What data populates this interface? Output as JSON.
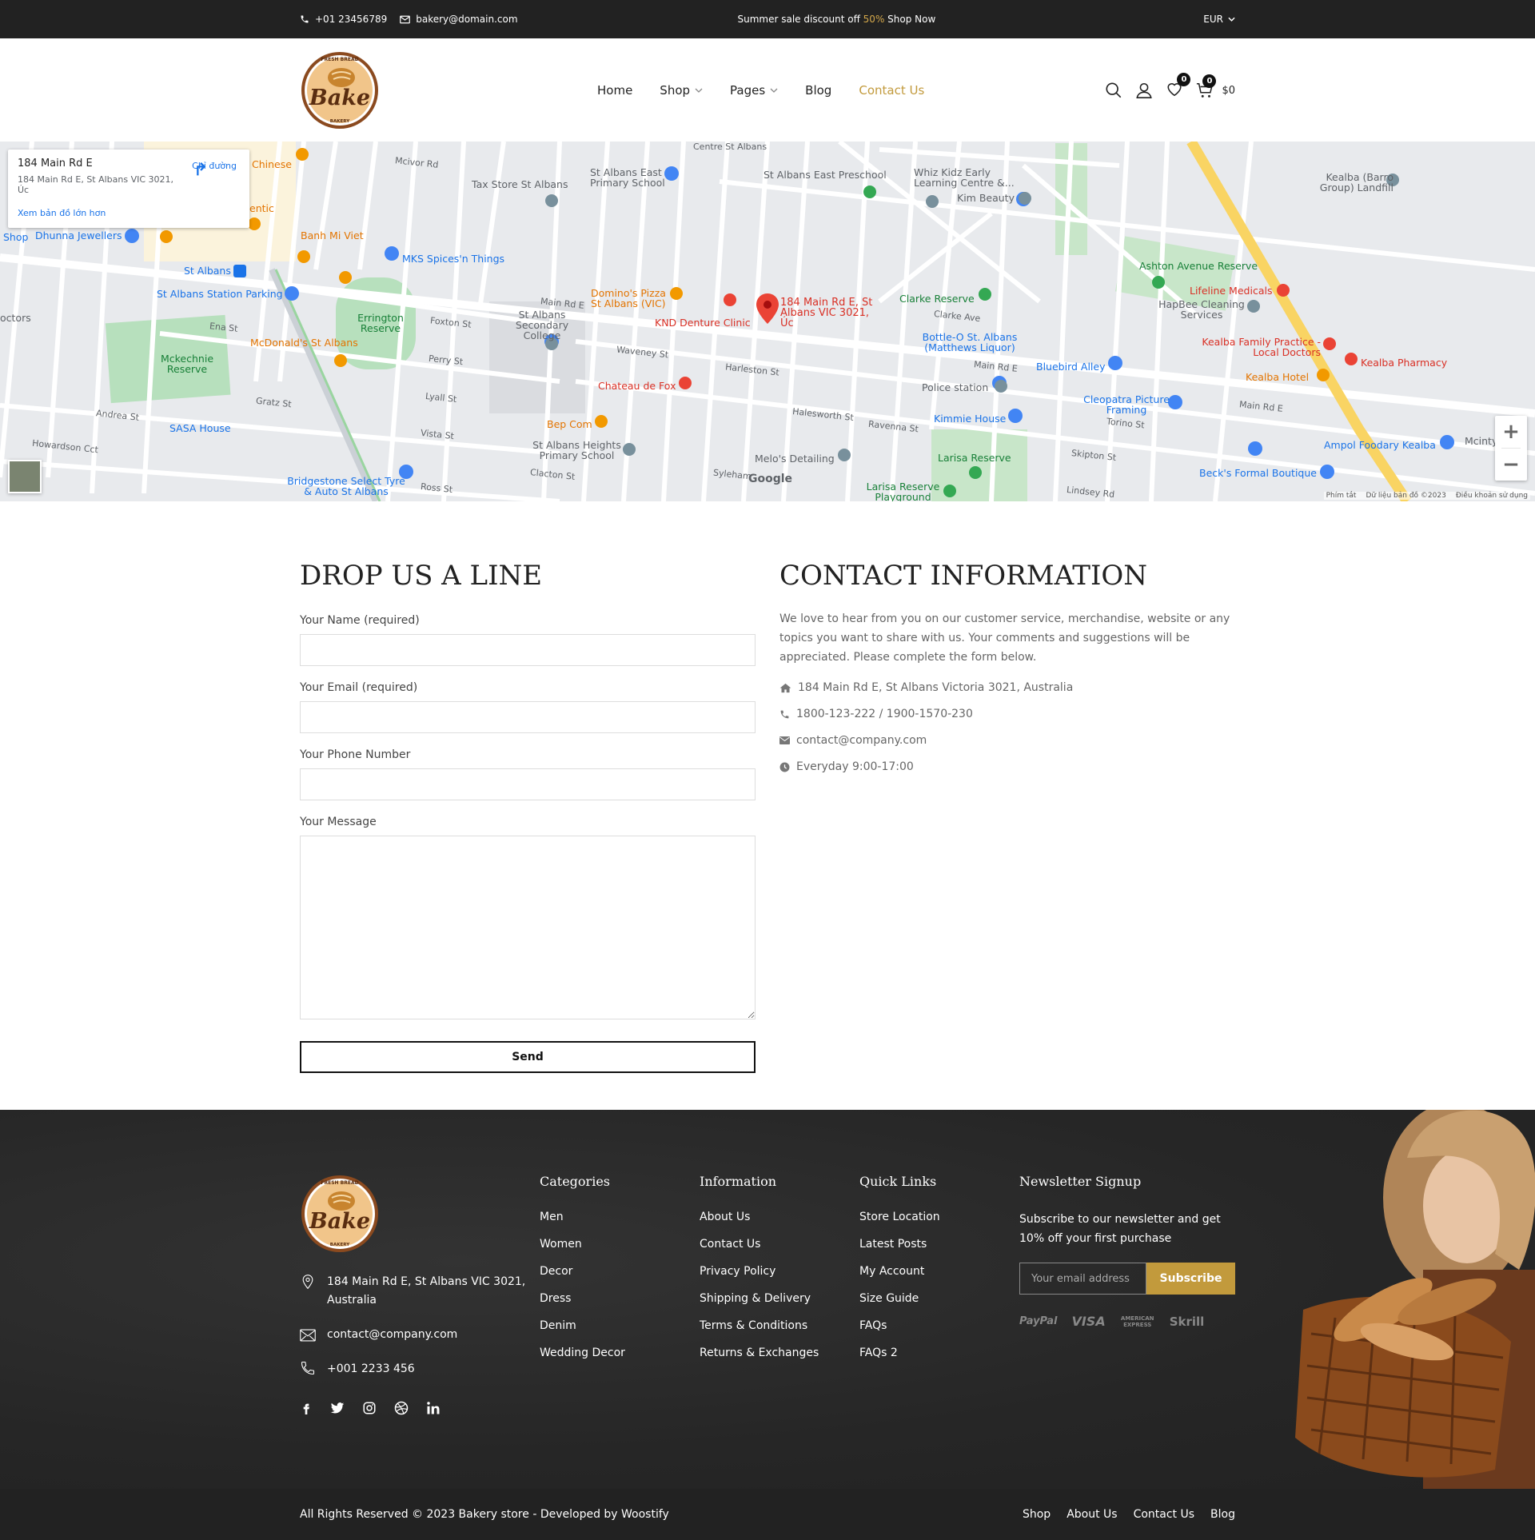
{
  "topbar": {
    "phone": "+01 23456789",
    "email": "bakery@domain.com",
    "promo_prefix": "Summer sale discount off ",
    "promo_highlight": "50%",
    "promo_suffix": " Shop Now",
    "currency": "EUR"
  },
  "logo": {
    "top_text": "FRESH BREAD",
    "main_text": "Bake",
    "bottom_text": "BAKERY"
  },
  "nav": {
    "items": [
      {
        "label": "Home"
      },
      {
        "label": "Shop"
      },
      {
        "label": "Pages"
      },
      {
        "label": "Blog"
      },
      {
        "label": "Contact Us"
      }
    ]
  },
  "header_icons": {
    "wishlist_count": "0",
    "cart_count": "0",
    "cart_total": "$0"
  },
  "map": {
    "place_title": "184 Main Rd E",
    "place_address": "184 Main Rd E, St Albans VIC 3021, Úc",
    "larger_map_link": "Xem bản đồ lớn hơn",
    "directions": "Chỉ đường",
    "pin_label": "184 Main Rd E, St Albans VIC 3021, Úc",
    "google": "Google",
    "footer_links": [
      "Phím tắt",
      "Dữ liệu bản đồ ©2023",
      "Điều khoản sử dụng"
    ],
    "labels": {
      "l1": "Tax Store St Albans",
      "l2": "St Albans East Primary School",
      "l3": "St Albans East Preschool",
      "l4": "Whiz Kidz Early Learning Centre &...",
      "l5": "Kim Beauty",
      "l6": "Kealba (Barro Group) Landfill",
      "l7": "Dhunna Jewellers",
      "l8": "Banh Mi Viet",
      "l9": "MKS Spices'n Things",
      "l10": "St Albans",
      "l11": "St Albans Station Parking",
      "l12": "Errington Reserve",
      "l13": "Domino's Pizza St Albans (VIC)",
      "l14": "St Albans Secondary College",
      "l15": "KND Denture Clinic",
      "l16": "Clarke Reserve",
      "l17": "Ashton Avenue Reserve",
      "l18": "Lifeline Medicals",
      "l19": "HapBee Cleaning Services",
      "l20": "Mckechnie Reserve",
      "l21": "McDonald's St Albans",
      "l22": "Chateau de Fox",
      "l23": "Bottle-O St. Albans (Matthews Liquor)",
      "l24": "Bluebird Alley",
      "l25": "Kealba Family Practice - Local Doctors",
      "l26": "Kealba Pharmacy",
      "l27": "Kealba Hotel",
      "l28": "Police station",
      "l29": "SASA House",
      "l30": "Bep Com",
      "l31": "Kimmie House",
      "l32": "Cleopatra Picture Framing",
      "l33": "St Albans Heights Primary School",
      "l34": "Melo's Detailing",
      "l35": "Larisa Reserve",
      "l36": "Ampol Foodary Kealba",
      "l37": "Bridgestone Select Tyre & Auto St Albans",
      "l38": "Beck's Formal Boutique",
      "l39": "Larisa Reserve Playground",
      "l40": "Chinese",
      "l41": "Main Rd E",
      "l42": "Main Rd E",
      "l43": "Harleston St",
      "l44": "Halesworth St",
      "l45": "Ravenna St",
      "l46": "Clarke Ave",
      "l47": "Foxton St",
      "l48": "Waveney St",
      "l49": "Perry St",
      "l50": "Lyall St",
      "l51": "Vista St",
      "l52": "Gratz St",
      "l53": "Andrea St",
      "l54": "Howardson Cct",
      "l55": "Ross St",
      "l56": "Clacton St",
      "l57": "Syleham",
      "l58": "Torino St",
      "l59": "Skipton St",
      "l60": "Lindsey Rd",
      "l61": "Mcivor Rd",
      "l62": "Ena St",
      "l63": "Main Rd E",
      "l64": "Shop",
      "l65": "octors",
      "l66": "Mcintyr",
      "l67": "entic",
      "l68": "Centre St Albans"
    }
  },
  "form": {
    "title": "DROP US A LINE",
    "name_label": "Your Name (required)",
    "email_label": "Your Email (required)",
    "phone_label": "Your Phone Number",
    "message_label": "Your Message",
    "send_label": "Send"
  },
  "contact": {
    "title": "CONTACT INFORMATION",
    "description": "We love to hear from you on our customer service, merchandise, website or any topics you want to share with us. Your comments and suggestions will be appreciated. Please complete the form below.",
    "address": "184 Main Rd E, St Albans Victoria 3021, Australia",
    "phone": "1800-123-222 / 1900-1570-230",
    "email": "contact@company.com",
    "hours": "Everyday 9:00-17:00"
  },
  "footer": {
    "address": "184 Main Rd E, St Albans VIC 3021, Australia",
    "email": "contact@company.com",
    "phone": "+001 2233 456",
    "categories": {
      "title": "Categories",
      "items": [
        "Men",
        "Women",
        "Decor",
        "Dress",
        "Denim",
        "Wedding Decor"
      ]
    },
    "information": {
      "title": "Information",
      "items": [
        "About Us",
        "Contact Us",
        "Privacy Policy",
        "Shipping & Delivery",
        "Terms & Conditions",
        "Returns & Exchanges"
      ]
    },
    "quick_links": {
      "title": "Quick Links",
      "items": [
        "Store Location",
        "Latest Posts",
        "My Account",
        "Size Guide",
        "FAQs",
        "FAQs 2"
      ]
    },
    "newsletter": {
      "title": "Newsletter Signup",
      "text": "Subscribe to our newsletter and get 10% off your first purchase",
      "placeholder": "Your email address",
      "button": "Subscribe"
    },
    "payments": {
      "paypal": "PayPal",
      "visa": "VISA",
      "amex": "AMERICAN EXPRESS",
      "skrill": "Skrill"
    }
  },
  "bottombar": {
    "copyright": "All Rights Reserved © 2023 Bakery store - Developed by Woostify",
    "links": [
      "Shop",
      "About Us",
      "Contact Us",
      "Blog"
    ]
  },
  "colors": {
    "accent": "#c29a3c",
    "dark": "#222222",
    "footer_bg": "#2a2a2a"
  }
}
